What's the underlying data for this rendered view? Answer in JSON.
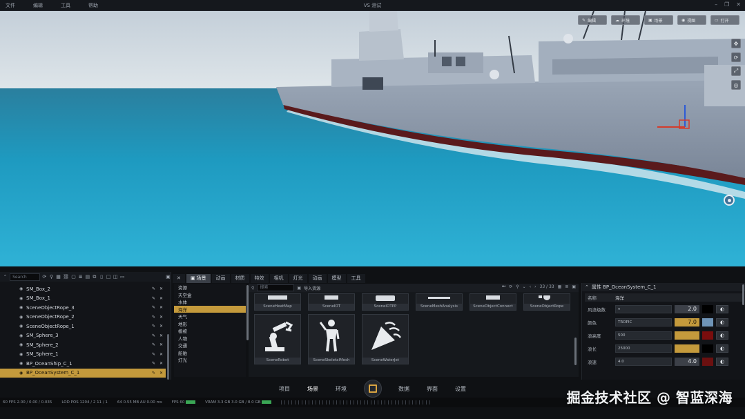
{
  "titlebar": {
    "menu": [
      "文件",
      "编辑",
      "工具",
      "帮助"
    ],
    "title": "VS 测试"
  },
  "viewport": {
    "toolbar": [
      "编辑",
      "环境",
      "场景",
      "视图",
      "打开"
    ]
  },
  "outliner": {
    "search_placeholder": "Search",
    "items": [
      {
        "name": "SM_Box_2",
        "selected": false
      },
      {
        "name": "SM_Box_1",
        "selected": false
      },
      {
        "name": "SceneObjectRope_3",
        "selected": false
      },
      {
        "name": "SceneObjectRope_2",
        "selected": false
      },
      {
        "name": "SceneObjectRope_1",
        "selected": false
      },
      {
        "name": "SM_Sphere_3",
        "selected": false
      },
      {
        "name": "SM_Sphere_2",
        "selected": false
      },
      {
        "name": "SM_Sphere_1",
        "selected": false
      },
      {
        "name": "BP_OceanShip_C_1",
        "selected": false
      },
      {
        "name": "BP_OceanSystem_C_1",
        "selected": true
      }
    ]
  },
  "tabs": [
    "场景",
    "动画",
    "材质",
    "特效",
    "相机",
    "灯光",
    "动画",
    "模型",
    "工具"
  ],
  "categories": [
    {
      "label": "资源",
      "selected": false
    },
    {
      "label": "天空盒",
      "selected": false
    },
    {
      "label": "水体",
      "selected": false
    },
    {
      "label": "海洋",
      "selected": true
    },
    {
      "label": "天气",
      "selected": false
    },
    {
      "label": "地形",
      "selected": false
    },
    {
      "label": "植被",
      "selected": false
    },
    {
      "label": "人物",
      "selected": false
    },
    {
      "label": "交通",
      "selected": false
    },
    {
      "label": "船舶",
      "selected": false
    },
    {
      "label": "灯光",
      "selected": false
    }
  ],
  "assets": {
    "search_placeholder": "搜索",
    "import_label": "导入资源",
    "pager": "33 / 33",
    "row1": [
      "SceneHeatMap",
      "SceneIOT",
      "SceneIOTPP",
      "SceneMeshAnalysis",
      "SceneObjectConnect",
      "SceneObjectRope"
    ],
    "row2": [
      "SceneRobot",
      "SceneSkeletalMesh",
      "SceneWaterJet"
    ]
  },
  "properties": {
    "header": "属性  BP_OceanSystem_C_1",
    "name_key": "名称",
    "name_val": "海洋",
    "rows": [
      {
        "key": "风浪级数",
        "input": "v",
        "num": "2.0",
        "swatch": "#000000"
      },
      {
        "key": "颜色",
        "input": "TROPIC",
        "num": "7.0",
        "swatch": "#6f94b7"
      },
      {
        "key": "浪高度",
        "input": "500",
        "num": "",
        "swatch": "#7a0d0d"
      },
      {
        "key": "浪长",
        "input": "25000",
        "num": "",
        "swatch": "#000000"
      },
      {
        "key": "浪速",
        "input": "4.0",
        "num": "4.0",
        "swatch": "#6b1010"
      }
    ]
  },
  "bottom_nav": [
    "项目",
    "场景",
    "环境",
    "数据",
    "界面",
    "设置"
  ],
  "status": {
    "left": "60 FPS  2.00 / 0.00 / 0.035",
    "mid1": "LOD  POS  1204 / 2  11 / 1",
    "mid2": "64    0.55 MB    AU    0.00 ms",
    "mid3": "FPS  60",
    "mid4": "VRAM  3.3 GB  3.0 GB / 8.0 GB"
  },
  "watermark": "掘金技术社区 @ 智蓝深海",
  "colors": {
    "accent": "#c49a3c",
    "panel": "#121418"
  }
}
